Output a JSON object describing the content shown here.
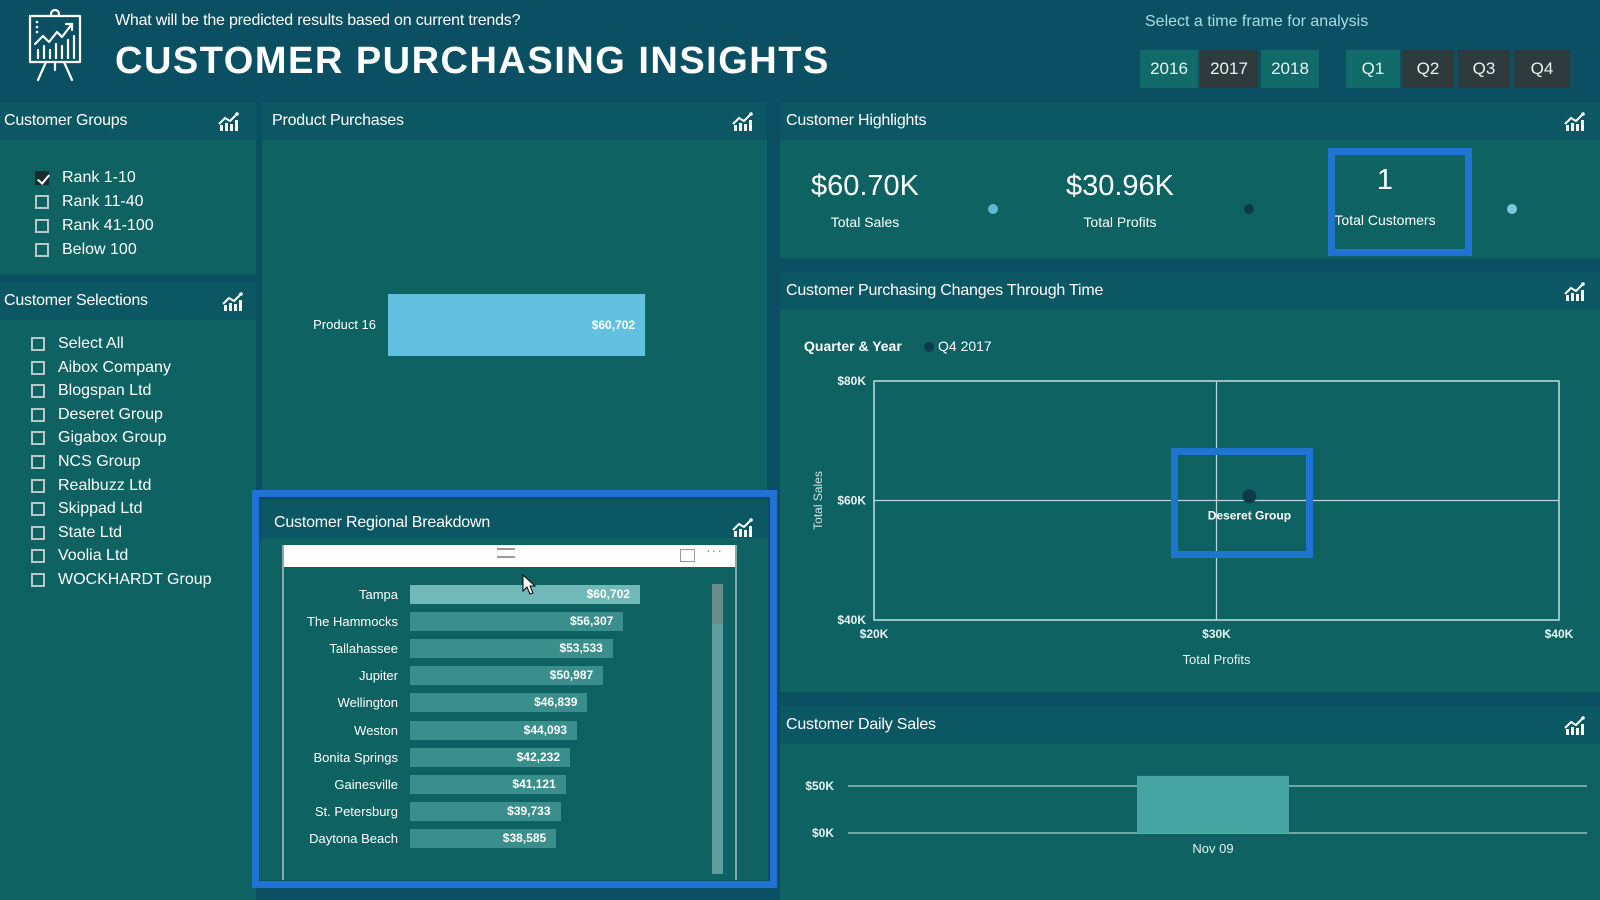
{
  "header": {
    "subtitle": "What will be the predicted results based on current trends?",
    "title": "CUSTOMER PURCHASING INSIGHTS",
    "logo_icon": "presentation-chart-icon",
    "time_frame_label": "Select a time frame for analysis",
    "years": [
      {
        "label": "2016",
        "selected": false
      },
      {
        "label": "2017",
        "selected": true
      },
      {
        "label": "2018",
        "selected": false
      }
    ],
    "quarters": [
      {
        "label": "Q1",
        "selected": false
      },
      {
        "label": "Q2",
        "selected": true
      },
      {
        "label": "Q3",
        "selected": true
      },
      {
        "label": "Q4",
        "selected": true
      }
    ]
  },
  "customer_groups": {
    "title": "Customer Groups",
    "items": [
      {
        "label": "Rank 1-10",
        "checked": true
      },
      {
        "label": "Rank 11-40",
        "checked": false
      },
      {
        "label": "Rank 41-100",
        "checked": false
      },
      {
        "label": "Below 100",
        "checked": false
      }
    ]
  },
  "customer_selections": {
    "title": "Customer Selections",
    "items": [
      {
        "label": "Select All",
        "checked": false
      },
      {
        "label": "Aibox Company",
        "checked": false
      },
      {
        "label": "Blogspan Ltd",
        "checked": false
      },
      {
        "label": "Deseret Group",
        "checked": false
      },
      {
        "label": "Gigabox Group",
        "checked": false
      },
      {
        "label": "NCS Group",
        "checked": false
      },
      {
        "label": "Realbuzz Ltd",
        "checked": false
      },
      {
        "label": "Skippad Ltd",
        "checked": false
      },
      {
        "label": "State Ltd",
        "checked": false
      },
      {
        "label": "Voolia Ltd",
        "checked": false
      },
      {
        "label": "WOCKHARDT Group",
        "checked": false
      }
    ]
  },
  "product_purchases": {
    "title": "Product Purchases"
  },
  "customer_highlights": {
    "title": "Customer Highlights",
    "kpis": [
      {
        "value": "$60.70K",
        "label": "Total Sales"
      },
      {
        "value": "$30.96K",
        "label": "Total Profits"
      },
      {
        "value": "1",
        "label": "Total Customers"
      }
    ],
    "dot_colors": [
      "#5fb8d4",
      "#0d3a4a",
      "#7fc8dc"
    ]
  },
  "regional_breakdown": {
    "title": "Customer Regional Breakdown"
  },
  "purchasing_changes": {
    "title": "Customer Purchasing Changes Through Time",
    "legend_title": "Quarter & Year",
    "legend_item": "Q4 2017"
  },
  "daily_sales": {
    "title": "Customer Daily Sales"
  },
  "colors": {
    "background": "#0b4f63",
    "panel": "#0f6262",
    "panel_header": "#0b5864",
    "highlight": "#1f74d1",
    "product_bar": "#62c0e0",
    "region_bar": "#3a8f8c",
    "region_bar_first": "#70b9b8",
    "daily_bar": "#45a3a1"
  },
  "chart_data": [
    {
      "id": "product_purchases",
      "type": "bar",
      "orientation": "horizontal",
      "title": "Product Purchases",
      "categories": [
        "Product 16"
      ],
      "values": [
        60702
      ],
      "data_labels": [
        "$60,702"
      ],
      "xlim": [
        0,
        85000
      ]
    },
    {
      "id": "regional_breakdown",
      "type": "bar",
      "orientation": "horizontal",
      "title": "Customer Regional Breakdown",
      "categories": [
        "Tampa",
        "The Hammocks",
        "Tallahassee",
        "Jupiter",
        "Wellington",
        "Weston",
        "Bonita Springs",
        "Gainesville",
        "St. Petersburg",
        "Daytona Beach"
      ],
      "values": [
        60702,
        56307,
        53533,
        50987,
        46839,
        44093,
        42232,
        41121,
        39733,
        38585
      ],
      "data_labels": [
        "$60,702",
        "$56,307",
        "$53,533",
        "$50,987",
        "$46,839",
        "$44,093",
        "$42,232",
        "$41,121",
        "$39,733",
        "$38,585"
      ]
    },
    {
      "id": "purchasing_changes",
      "type": "scatter",
      "title": "Customer Purchasing Changes Through Time",
      "xlabel": "Total Profits",
      "ylabel": "Total Sales",
      "xlim": [
        20000,
        40000
      ],
      "ylim": [
        40000,
        80000
      ],
      "xticks": [
        "$20K",
        "$30K",
        "$40K"
      ],
      "yticks": [
        "$80K",
        "$60K",
        "$40K"
      ],
      "xtick_values": [
        20000,
        30000,
        40000
      ],
      "ytick_values": [
        80000,
        60000,
        40000
      ],
      "legend": {
        "title": "Quarter & Year",
        "items": [
          "Q4 2017"
        ],
        "placement": "top-left"
      },
      "points": [
        {
          "x": 30960,
          "y": 60700,
          "label": "Deseret Group",
          "series": "Q4 2017"
        }
      ],
      "grid": true
    },
    {
      "id": "daily_sales",
      "type": "bar",
      "title": "Customer Daily Sales",
      "categories": [
        "Nov 09"
      ],
      "values": [
        60702
      ],
      "ylim": [
        0,
        60000
      ],
      "yticks": [
        "$50K",
        "$0K"
      ],
      "ytick_values": [
        50000,
        0
      ]
    }
  ]
}
